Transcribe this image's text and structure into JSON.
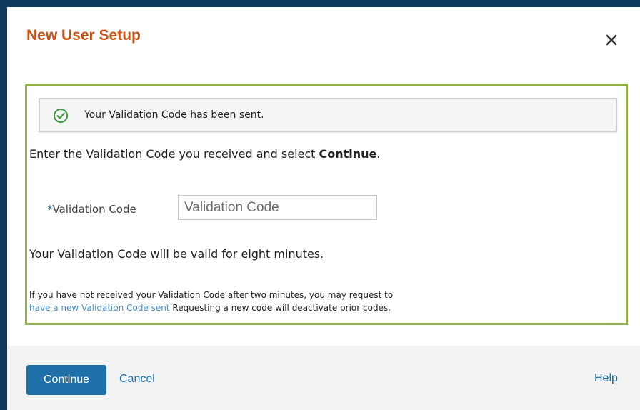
{
  "dialog": {
    "title": "New User Setup",
    "close_icon": "close-icon"
  },
  "alert": {
    "icon": "check-circle-icon",
    "message": "Your Validation Code has been sent."
  },
  "instruction": {
    "text": "Enter the Validation Code you received and select ",
    "bold": "Continue",
    "end": "."
  },
  "field": {
    "required_mark": "*",
    "label": "Validation Code",
    "placeholder": "Validation Code",
    "value": ""
  },
  "validity_text": "Your Validation Code will be valid for eight minutes.",
  "note": {
    "line1": "If you have not received your Validation Code after two minutes, you may request to",
    "link": "have a new Validation Code sent",
    "line2": " Requesting a new code will deactivate prior codes."
  },
  "footer": {
    "continue_label": "Continue",
    "cancel_label": "Cancel",
    "help_label": "Help"
  },
  "colors": {
    "title": "#cc5216",
    "accent": "#1f6fa8",
    "success": "#3f9a3f",
    "box_border": "#8fb04a",
    "frame": "#0e3a5c"
  }
}
